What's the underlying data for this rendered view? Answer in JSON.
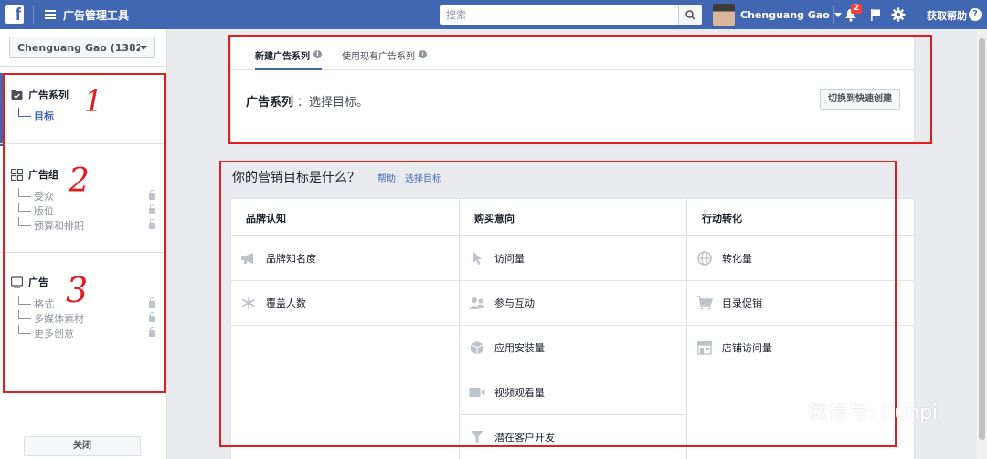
{
  "topbar": {
    "logo": "f",
    "app_title": "广告管理工具",
    "search_placeholder": "搜索",
    "user_name": "Chenguang Gao",
    "notification_count": "2",
    "help_label": "获取帮助",
    "help_icon": "?"
  },
  "sidebar": {
    "account": "Chenguang Gao (138204...",
    "sections": [
      {
        "title": "广告系列",
        "icon": "campaign-icon",
        "items": [
          {
            "label": "目标",
            "active": true
          }
        ]
      },
      {
        "title": "广告组",
        "icon": "adset-grid-icon",
        "items": [
          {
            "label": "受众",
            "locked": true
          },
          {
            "label": "版位",
            "locked": true
          },
          {
            "label": "预算和排期",
            "locked": true
          }
        ]
      },
      {
        "title": "广告",
        "icon": "ad-monitor-icon",
        "items": [
          {
            "label": "格式",
            "locked": true
          },
          {
            "label": "多媒体素材",
            "locked": true
          },
          {
            "label": "更多创意",
            "locked": true
          }
        ]
      }
    ],
    "close_label": "关闭"
  },
  "campaign_card": {
    "tabs": [
      {
        "label": "新建广告系列",
        "active": true
      },
      {
        "label": "使用现有广告系列",
        "active": false
      }
    ],
    "label": "广告系列",
    "text": "：选择目标。",
    "switch_button": "切换到快速创建"
  },
  "objectives": {
    "title": "你的营销目标是什么？",
    "help_link": "帮助：选择目标",
    "columns": [
      {
        "header": "品牌认知",
        "items": [
          {
            "label": "品牌知名度",
            "icon": "megaphone-icon"
          },
          {
            "label": "覆盖人数",
            "icon": "reach-asterisk-icon"
          }
        ]
      },
      {
        "header": "购买意向",
        "items": [
          {
            "label": "访问量",
            "icon": "cursor-icon"
          },
          {
            "label": "参与互动",
            "icon": "people-icon"
          },
          {
            "label": "应用安装量",
            "icon": "box-icon"
          },
          {
            "label": "视频观看量",
            "icon": "video-camera-icon"
          },
          {
            "label": "潜在客户开发",
            "icon": "funnel-icon"
          }
        ]
      },
      {
        "header": "行动转化",
        "items": [
          {
            "label": "转化量",
            "icon": "globe-icon"
          },
          {
            "label": "目录促销",
            "icon": "shopping-cart-icon"
          },
          {
            "label": "店铺访问量",
            "icon": "store-icon"
          }
        ]
      }
    ]
  },
  "annotations": {
    "marks": [
      "1",
      "2",
      "3"
    ],
    "color": "#e02020"
  },
  "watermark": "微信号: ifunpi",
  "colors": {
    "brand": "#4267b2",
    "annotation": "#e02020"
  }
}
